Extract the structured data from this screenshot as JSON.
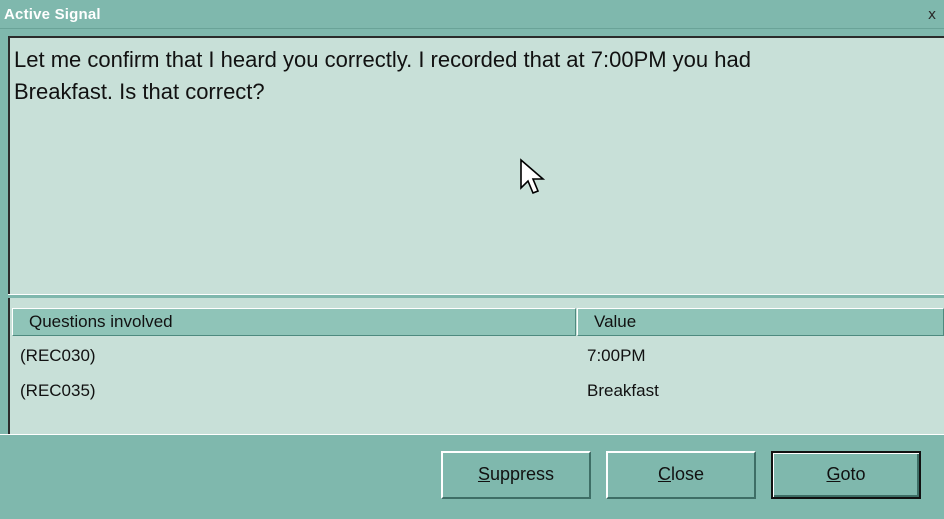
{
  "window": {
    "title": "Active Signal",
    "close_glyph": "x"
  },
  "message": {
    "line1": "Let me confirm that I heard you correctly. I recorded that at 7:00PM you had",
    "line2": "Breakfast. Is that correct?"
  },
  "grid": {
    "headers": [
      "Questions involved",
      "Value"
    ],
    "rows": [
      {
        "question": "(REC030)",
        "value": "7:00PM"
      },
      {
        "question": "(REC035)",
        "value": "Breakfast"
      }
    ]
  },
  "buttons": {
    "suppress": {
      "mnemonic": "S",
      "rest": "uppress"
    },
    "close": {
      "mnemonic": "C",
      "rest": "lose"
    },
    "goto": {
      "mnemonic": "G",
      "rest": "oto"
    }
  },
  "colors": {
    "window_bg": "#7fb8ad",
    "content_bg": "#c8e0d8",
    "title_text": "#ffffff"
  },
  "icons": {
    "close": "close-icon",
    "pointer": "mouse-pointer-icon"
  }
}
